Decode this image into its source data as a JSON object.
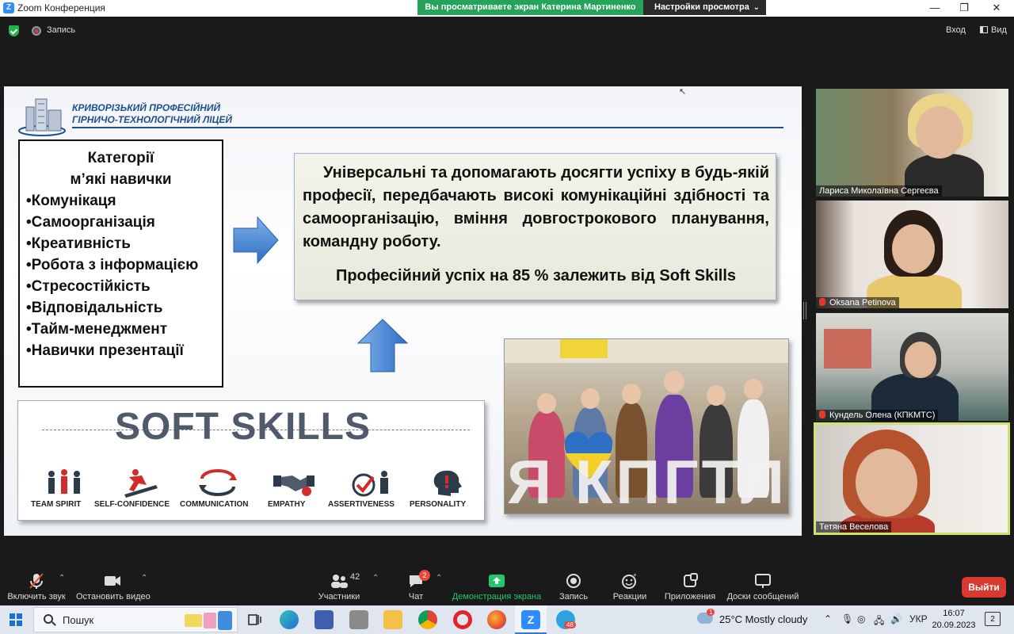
{
  "window": {
    "title": "Zoom Конференция",
    "share_banner": "Вы просматриваете экран Катерина Мартиненко",
    "view_options": "Настройки просмотра"
  },
  "top_strip": {
    "record_label": "Запись",
    "entry_label": "Вход",
    "view_label": "Вид"
  },
  "slide": {
    "school_name_line1": "КРИВОРІЗЬКИЙ ПРОФЕСІЙНИЙ",
    "school_name_line2": "ГІРНИЧО-ТЕХНОЛОГІЧНИЙ ЛІЦЕЙ",
    "categories_title_line1": "Категорії",
    "categories_title_line2": "м’які навички",
    "categories": [
      "•Комунікаця",
      "•Самоорганізація",
      "•Креативність",
      "•Робота з інформацією",
      "•Стресостійкість",
      "•Відповідальність",
      "•Тайм-менеджмент",
      "•Навички презентації"
    ],
    "description": "Універсальні та допомагають досягти успіху в будь-якій професії, передбачають високі комунікаційні здібності та самоорганізацію, вміння довгострокового планування, командну роботу.",
    "statement": "Професійний успіх на 85 % залежить від Soft Skills",
    "soft_skills_title": "SOFT SKILLS",
    "soft_skills_labels": [
      "TEAM SPIRIT",
      "SELF-CONFIDENCE",
      "COMMUNICATION",
      "EMPATHY",
      "ASSERTIVENESS",
      "PERSONALITY"
    ],
    "photo_letters": "Я КПГТЛ"
  },
  "participants": [
    {
      "name": "Лариса Миколаївна Сергеєва",
      "muted": false
    },
    {
      "name": "Oksana Petinova",
      "muted": true
    },
    {
      "name": "Кундель Олена (КПКМТС)",
      "muted": true
    },
    {
      "name": "Тетяна Веселова",
      "muted": false
    }
  ],
  "toolbar": {
    "unmute_label": "Включить звук",
    "stop_video_label": "Остановить видео",
    "participants_label": "Участники",
    "participants_count": "42",
    "chat_label": "Чат",
    "chat_badge": "2",
    "share_label": "Демонстрация экрана",
    "record_label": "Запись",
    "reactions_label": "Реакции",
    "apps_label": "Приложения",
    "whiteboards_label": "Доски сообщений",
    "leave_label": "Выйти"
  },
  "taskbar": {
    "search_placeholder": "Пошук",
    "telegram_badge": "48",
    "weather": "25°C  Mostly cloudy",
    "weather_badge": "1",
    "language": "УКР",
    "time": "16:07",
    "date": "20.09.2023",
    "notifications": "2"
  },
  "colors": {
    "share_banner": "#25a35a",
    "leave_button": "#d83a2f",
    "active_speaker_border": "#cfe26e",
    "school_blue": "#1d4f8f"
  }
}
